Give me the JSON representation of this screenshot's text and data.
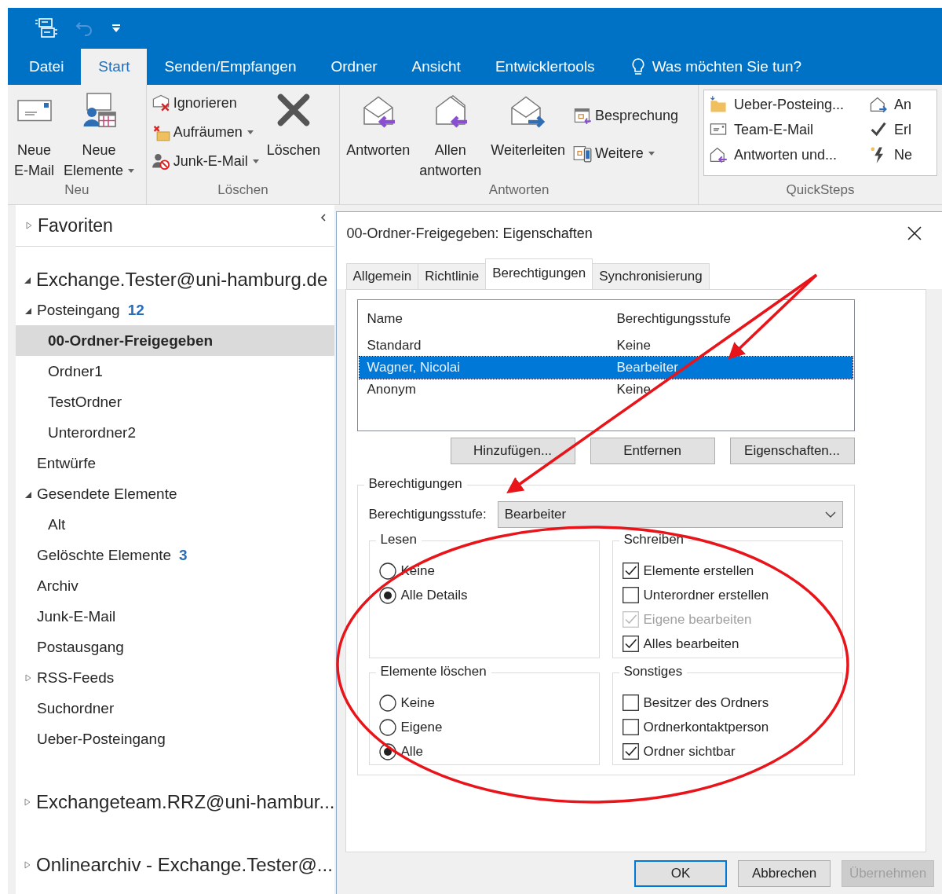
{
  "ribbon": {
    "tabs": [
      {
        "label": "Datei",
        "selected": false
      },
      {
        "label": "Start",
        "selected": true
      },
      {
        "label": "Senden/Empfangen",
        "selected": false
      },
      {
        "label": "Ordner",
        "selected": false
      },
      {
        "label": "Ansicht",
        "selected": false
      },
      {
        "label": "Entwicklertools",
        "selected": false
      }
    ],
    "tell_me": "Was möchten Sie tun?",
    "groups": [
      {
        "label": "Neu",
        "items": [
          {
            "kind": "large",
            "lines": [
              "Neue",
              "E-Mail"
            ],
            "dropdown": false
          },
          {
            "kind": "large",
            "lines": [
              "Neue",
              "Elemente"
            ],
            "dropdown": true
          }
        ]
      },
      {
        "label": "Löschen",
        "items": [
          {
            "kind": "stack",
            "buttons": [
              {
                "label": "Ignorieren",
                "dropdown": false
              },
              {
                "label": "Aufräumen",
                "dropdown": true
              },
              {
                "label": "Junk-E-Mail",
                "dropdown": true
              }
            ]
          },
          {
            "kind": "large",
            "lines": [
              "Löschen"
            ],
            "dropdown": false
          }
        ]
      },
      {
        "label": "Antworten",
        "items": [
          {
            "kind": "large",
            "lines": [
              "Antworten"
            ],
            "dropdown": false
          },
          {
            "kind": "large",
            "lines": [
              "Allen",
              "antworten"
            ],
            "dropdown": false
          },
          {
            "kind": "large",
            "lines": [
              "Weiterleiten"
            ],
            "dropdown": false
          },
          {
            "kind": "stack",
            "buttons": [
              {
                "label": "Besprechung",
                "dropdown": false
              },
              {
                "label": "Weitere",
                "dropdown": true
              }
            ]
          }
        ]
      },
      {
        "label": "QuickSteps",
        "items": [
          {
            "kind": "gallery",
            "buttons": [
              {
                "label": "Ueber-Posteing..."
              },
              {
                "label": "Team-E-Mail"
              },
              {
                "label": "Antworten und..."
              },
              {
                "label": "An"
              },
              {
                "label": "Erl"
              },
              {
                "label": "Ne"
              }
            ]
          }
        ]
      }
    ]
  },
  "navigation": {
    "favorites": {
      "label": "Favoriten",
      "expanded": false
    },
    "accounts": [
      {
        "label": "Exchange.Tester@uni-hamburg.de",
        "expanded": true,
        "folders": [
          {
            "name": "Posteingang",
            "count": "12",
            "selected": false,
            "expanded": true,
            "children": [
              {
                "name": "00-Ordner-Freigegeben",
                "selected": true
              },
              {
                "name": "Ordner1",
                "selected": false
              },
              {
                "name": "TestOrdner",
                "selected": false
              },
              {
                "name": "Unterordner2",
                "selected": false
              }
            ]
          },
          {
            "name": "Entwürfe",
            "selected": false
          },
          {
            "name": "Gesendete Elemente",
            "selected": false,
            "expanded": true,
            "children": [
              {
                "name": "Alt",
                "selected": false
              }
            ]
          },
          {
            "name": "Gelöschte Elemente",
            "count": "3",
            "selected": false
          },
          {
            "name": "Archiv",
            "selected": false
          },
          {
            "name": "Junk-E-Mail",
            "selected": false
          },
          {
            "name": "Postausgang",
            "selected": false
          },
          {
            "name": "RSS-Feeds",
            "selected": false,
            "expanded": false
          },
          {
            "name": "Suchordner",
            "selected": false
          },
          {
            "name": "Ueber-Posteingang",
            "selected": false
          }
        ]
      },
      {
        "label": "Exchangeteam.RRZ@uni-hambur...",
        "expanded": false
      },
      {
        "label": "Onlinearchiv - Exchange.Tester@...",
        "expanded": false
      }
    ]
  },
  "dialog": {
    "title": "00-Ordner-Freigegeben: Eigenschaften",
    "tabs": [
      {
        "label": "Allgemein",
        "selected": false
      },
      {
        "label": "Richtlinie",
        "selected": false
      },
      {
        "label": "Berechtigungen",
        "selected": true
      },
      {
        "label": "Synchronisierung",
        "selected": false
      }
    ],
    "columns": [
      "Name",
      "Berechtigungsstufe"
    ],
    "rows": [
      {
        "name": "Standard",
        "level_name": "Keine",
        "selected": false
      },
      {
        "name": "Wagner, Nicolai",
        "level_name": "Bearbeiter",
        "selected": true
      },
      {
        "name": "Anonym",
        "level_name": "Keine",
        "selected": false
      }
    ],
    "list_buttons": [
      "Hinzufügen...",
      "Entfernen",
      "Eigenschaften..."
    ],
    "permissions": {
      "legend": "Berechtigungen",
      "level_label": "Berechtigungsstufe:",
      "level_value": "Bearbeiter",
      "groups": [
        {
          "legend": "Lesen",
          "kind": "radio",
          "options": [
            {
              "label": "Keine",
              "selected": false
            },
            {
              "label": "Alle Details",
              "selected": true
            }
          ]
        },
        {
          "legend": "Schreiben",
          "kind": "checkbox",
          "options": [
            {
              "label": "Elemente erstellen",
              "checked": true,
              "disabled": false
            },
            {
              "label": "Unterordner erstellen",
              "checked": false,
              "disabled": false
            },
            {
              "label": "Eigene bearbeiten",
              "checked": true,
              "disabled": true
            },
            {
              "label": "Alles bearbeiten",
              "checked": true,
              "disabled": false
            }
          ]
        },
        {
          "legend": "Elemente löschen",
          "kind": "radio",
          "options": [
            {
              "label": "Keine",
              "selected": false
            },
            {
              "label": "Eigene",
              "selected": false
            },
            {
              "label": "Alle",
              "selected": true
            }
          ]
        },
        {
          "legend": "Sonstiges",
          "kind": "checkbox",
          "options": [
            {
              "label": "Besitzer des Ordners",
              "checked": false,
              "disabled": false
            },
            {
              "label": "Ordnerkontaktperson",
              "checked": false,
              "disabled": false
            },
            {
              "label": "Ordner sichtbar",
              "checked": true,
              "disabled": false
            }
          ]
        }
      ]
    },
    "footer_buttons": [
      {
        "label": "OK",
        "default": true,
        "disabled": false
      },
      {
        "label": "Abbrechen",
        "default": false,
        "disabled": false
      },
      {
        "label": "Übernehmen",
        "default": false,
        "disabled": true
      }
    ]
  }
}
